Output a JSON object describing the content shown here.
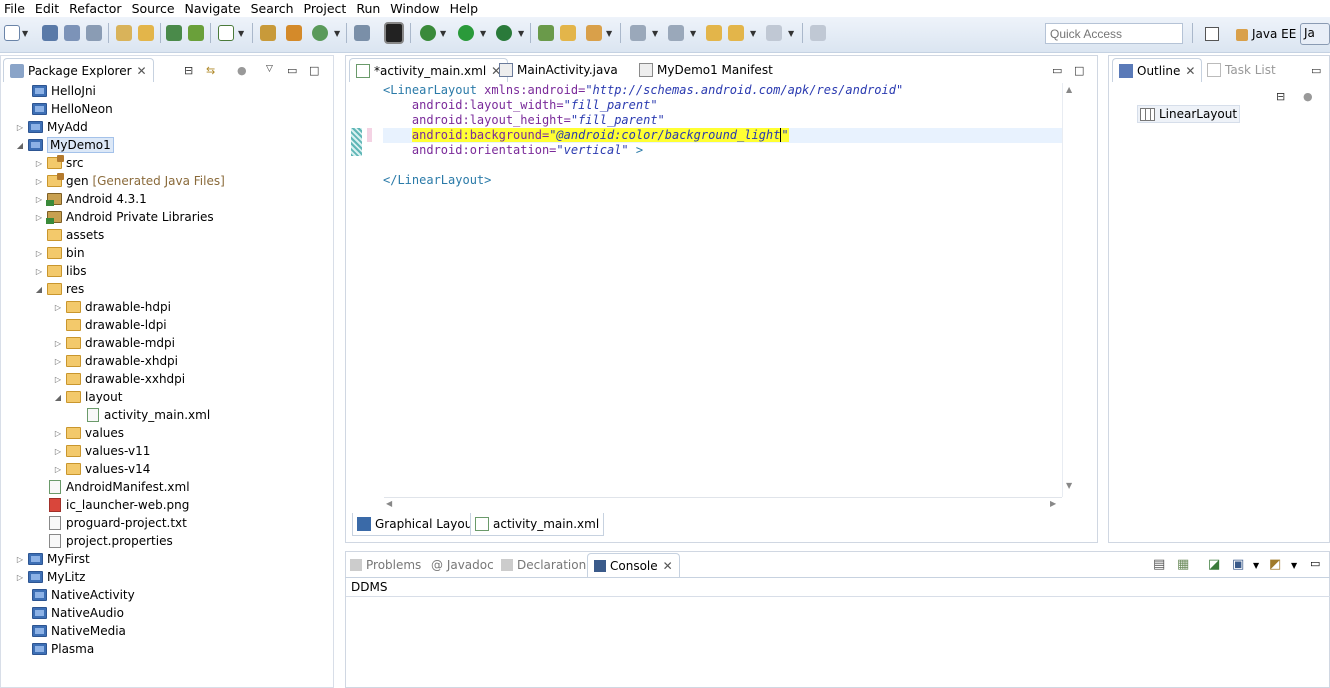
{
  "menu": [
    "File",
    "Edit",
    "Refactor",
    "Source",
    "Navigate",
    "Search",
    "Project",
    "Run",
    "Window",
    "Help"
  ],
  "toolbar": {
    "quick_access_placeholder": "Quick Access",
    "perspective_javaee": "Java EE",
    "perspective_java": "Ja"
  },
  "package_explorer": {
    "title": "Package Explorer",
    "items": [
      {
        "label": "HelloJni",
        "extra": ""
      },
      {
        "label": "HelloNeon",
        "extra": ""
      },
      {
        "label": "MyAdd",
        "extra": ""
      },
      {
        "label": "MyDemo1",
        "extra": ""
      },
      {
        "label": "src",
        "extra": ""
      },
      {
        "label": "gen",
        "extra": "[Generated Java Files]"
      },
      {
        "label": "Android 4.3.1",
        "extra": ""
      },
      {
        "label": "Android Private Libraries",
        "extra": ""
      },
      {
        "label": "assets",
        "extra": ""
      },
      {
        "label": "bin",
        "extra": ""
      },
      {
        "label": "libs",
        "extra": ""
      },
      {
        "label": "res",
        "extra": ""
      },
      {
        "label": "drawable-hdpi",
        "extra": ""
      },
      {
        "label": "drawable-ldpi",
        "extra": ""
      },
      {
        "label": "drawable-mdpi",
        "extra": ""
      },
      {
        "label": "drawable-xhdpi",
        "extra": ""
      },
      {
        "label": "drawable-xxhdpi",
        "extra": ""
      },
      {
        "label": "layout",
        "extra": ""
      },
      {
        "label": "activity_main.xml",
        "extra": ""
      },
      {
        "label": "values",
        "extra": ""
      },
      {
        "label": "values-v11",
        "extra": ""
      },
      {
        "label": "values-v14",
        "extra": ""
      },
      {
        "label": "AndroidManifest.xml",
        "extra": ""
      },
      {
        "label": "ic_launcher-web.png",
        "extra": ""
      },
      {
        "label": "proguard-project.txt",
        "extra": ""
      },
      {
        "label": "project.properties",
        "extra": ""
      },
      {
        "label": "MyFirst",
        "extra": ""
      },
      {
        "label": "MyLitz",
        "extra": ""
      },
      {
        "label": "NativeActivity",
        "extra": ""
      },
      {
        "label": "NativeAudio",
        "extra": ""
      },
      {
        "label": "NativeMedia",
        "extra": ""
      },
      {
        "label": "Plasma",
        "extra": ""
      }
    ]
  },
  "editor": {
    "tabs": [
      {
        "label": "*activity_main.xml"
      },
      {
        "label": "MainActivity.java"
      },
      {
        "label": "MyDemo1 Manifest"
      }
    ],
    "code": {
      "l1_tag": "<LinearLayout ",
      "l1_attr": "xmlns:android=",
      "l1_val": "\"http://schemas.android.com/apk/res/android\"",
      "l2_attr": "android:layout_width=",
      "l2_val": "\"fill_parent\"",
      "l3_attr": "android:layout_height=",
      "l3_val": "\"fill_parent\"",
      "l4_attr": "android:background=",
      "l4_val": "\"@android:color/background_light",
      "l4_close": "\"",
      "l5_attr": "android:orientation=",
      "l5_val": "\"vertical\"",
      "l5_end": " >",
      "l7": "</LinearLayout>"
    },
    "bottom_tabs": [
      {
        "label": "Graphical Layout"
      },
      {
        "label": "activity_main.xml"
      }
    ]
  },
  "outline": {
    "title": "Outline",
    "task_list": "Task List",
    "item": "LinearLayout"
  },
  "console": {
    "tabs": [
      "Problems",
      "@ Javadoc",
      "Declaration",
      "Console"
    ],
    "content": "DDMS"
  }
}
